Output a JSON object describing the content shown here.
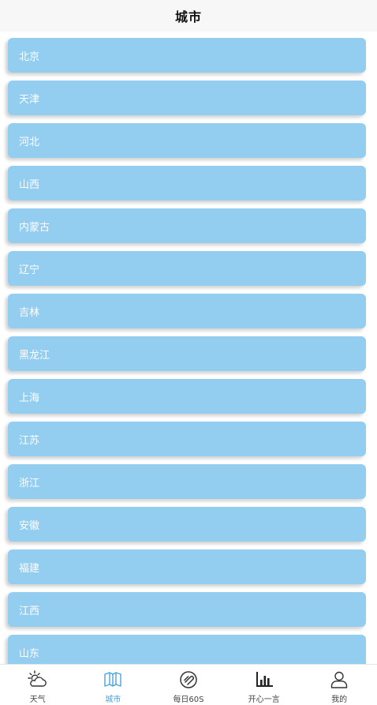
{
  "header": {
    "title": "城市"
  },
  "cities": [
    {
      "label": "北京"
    },
    {
      "label": "天津"
    },
    {
      "label": "河北"
    },
    {
      "label": "山西"
    },
    {
      "label": "内蒙古"
    },
    {
      "label": "辽宁"
    },
    {
      "label": "吉林"
    },
    {
      "label": "黑龙江"
    },
    {
      "label": "上海"
    },
    {
      "label": "江苏"
    },
    {
      "label": "浙江"
    },
    {
      "label": "安徽"
    },
    {
      "label": "福建"
    },
    {
      "label": "江西"
    },
    {
      "label": "山东"
    }
  ],
  "tabbar": {
    "active_color": "#4ba3dd",
    "card_color": "#93cdf0",
    "tabs": [
      {
        "label": "天气",
        "icon": "weather-icon"
      },
      {
        "label": "城市",
        "icon": "map-icon",
        "active": true
      },
      {
        "label": "每日60S",
        "icon": "disc-icon"
      },
      {
        "label": "开心一言",
        "icon": "bar-chart-icon"
      },
      {
        "label": "我的",
        "icon": "user-icon"
      }
    ]
  }
}
